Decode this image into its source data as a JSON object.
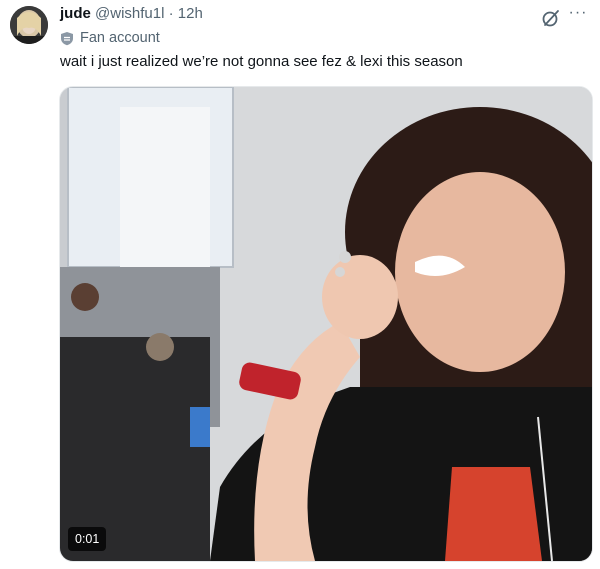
{
  "author": {
    "display_name": "jude",
    "handle": "@wishfu1l",
    "separator": "·",
    "time": "12h",
    "label": "Fan account"
  },
  "tweet": {
    "text": "wait i just realized we’re not gonna see fez & lexi this season"
  },
  "media": {
    "type": "video",
    "timestamp": "0:01"
  },
  "icons": {
    "grok": "grok-icon",
    "more": "more-options-icon",
    "label": "fan-account-shield-icon"
  }
}
